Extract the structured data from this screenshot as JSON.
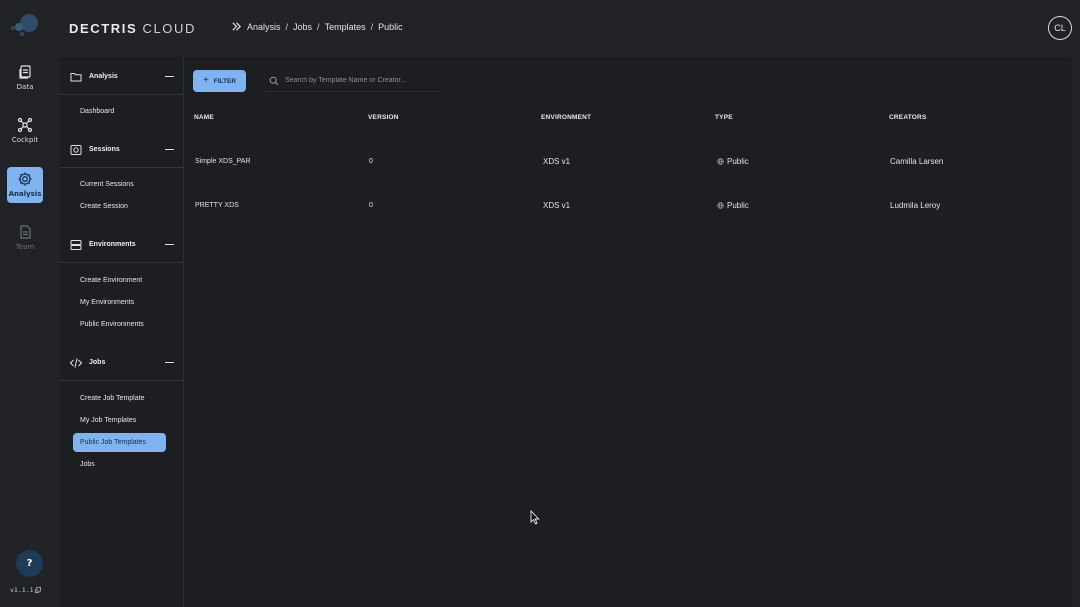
{
  "header": {
    "brand_primary": "DECTRIS",
    "brand_secondary": "CLOUD",
    "breadcrumb": [
      "Analysis",
      "Jobs",
      "Templates",
      "Public"
    ],
    "breadcrumb_sep": "/",
    "avatar_initials": "CL"
  },
  "rail": {
    "items": [
      {
        "label": "Data",
        "icon": "document-copy-icon"
      },
      {
        "label": "Cockpit",
        "icon": "network-icon"
      },
      {
        "label": "Analysis",
        "icon": "gear-icon"
      },
      {
        "label": "Team",
        "icon": "file-icon"
      }
    ],
    "help_label": "?",
    "version": "v1.1.1"
  },
  "sidebar": {
    "sections": [
      {
        "title": "Analysis",
        "icon": "folder-icon",
        "items": [
          "Dashboard"
        ]
      },
      {
        "title": "Sessions",
        "icon": "camera-icon",
        "items": [
          "Current Sessions",
          "Create Session"
        ]
      },
      {
        "title": "Environments",
        "icon": "server-icon",
        "items": [
          "Create Environment",
          "My Environments",
          "Public Environments"
        ]
      },
      {
        "title": "Jobs",
        "icon": "code-icon",
        "items": [
          "Create Job Template",
          "My Job Templates",
          "Public Job Templates",
          "Jobs"
        ]
      }
    ],
    "active_item": "Public Job Templates"
  },
  "toolbar": {
    "filter_label": "FILTER",
    "search_placeholder": "Search by Template Name or Creator..."
  },
  "table": {
    "columns": [
      "NAME",
      "VERSION",
      "ENVIRONMENT",
      "TYPE",
      "CREATORS"
    ],
    "rows": [
      {
        "name": "Simple XDS_PAR",
        "version": "0",
        "environment": "XDS v1",
        "type": "Public",
        "creators": "Camilla Larsen"
      },
      {
        "name": "PRETTY XDS",
        "version": "0",
        "environment": "XDS v1",
        "type": "Public",
        "creators": "Ludmila Leroy"
      }
    ]
  },
  "colors": {
    "background": "#202225",
    "panel": "#1c1e21",
    "accent": "#7fb4f0",
    "help_button": "#1d3a56"
  }
}
